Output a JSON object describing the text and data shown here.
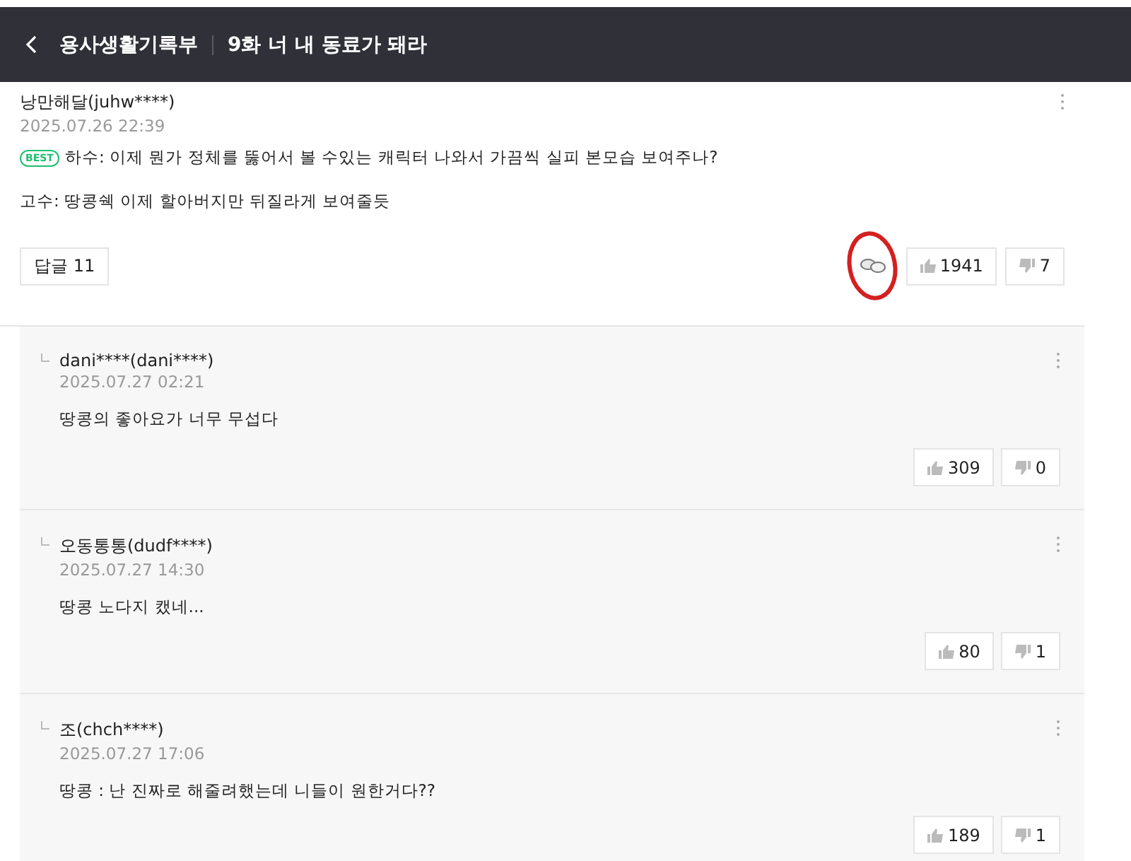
{
  "header": {
    "series": "용사생활기록부",
    "episode": "9화 너 내 동료가 돼라"
  },
  "comment": {
    "author": "낭만해달(juhw****)",
    "date": "2025.07.26 22:39",
    "badge": "BEST",
    "lines": [
      "하수: 이제 뭔가 정체를 뚫어서 볼 수있는 캐릭터 나와서 가끔씩 실피 본모습 보여주나?",
      "고수: 땅콩쉑 이제 할아버지만 뒤질라게 보여줄듯"
    ],
    "reply_button": "답글 11",
    "likes": "1941",
    "dislikes": "7"
  },
  "replies": [
    {
      "author": "dani****(dani****)",
      "date": "2025.07.27 02:21",
      "text": "땅콩의 좋아요가 너무 무섭다",
      "likes": "309",
      "dislikes": "0"
    },
    {
      "author": "오동통통(dudf****)",
      "date": "2025.07.27 14:30",
      "text": "땅콩 노다지 캤네...",
      "likes": "80",
      "dislikes": "1"
    },
    {
      "author": "조(chch****)",
      "date": "2025.07.27 17:06",
      "text": "땅콩 : 난 진짜로 해줄려했는데 니들이 원한거다??",
      "likes": "189",
      "dislikes": "1"
    }
  ]
}
